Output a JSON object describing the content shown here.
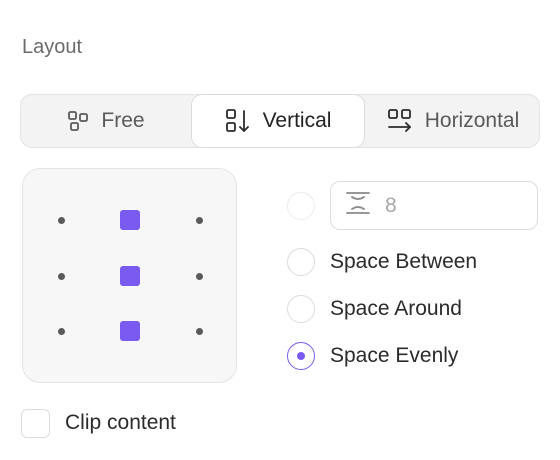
{
  "section": {
    "title": "Layout"
  },
  "layout_modes": {
    "selected": "Vertical",
    "items": [
      {
        "label": "Free",
        "icon": "free-layout-icon"
      },
      {
        "label": "Vertical",
        "icon": "vertical-layout-icon"
      },
      {
        "label": "Horizontal",
        "icon": "horizontal-layout-icon"
      }
    ]
  },
  "alignment": {
    "selected_column": "center",
    "rows": [
      "top",
      "middle",
      "bottom"
    ]
  },
  "spacing": {
    "gap_value": "8",
    "gap_icon": "vertical-gap-icon",
    "selected": "Space Evenly",
    "options": [
      "Space Between",
      "Space Around",
      "Space Evenly"
    ]
  },
  "clip_content": {
    "label": "Clip content",
    "checked": false
  },
  "colors": {
    "accent": "#7a5af0",
    "border": "#dddddd",
    "muted_text": "#6b6b6b"
  }
}
